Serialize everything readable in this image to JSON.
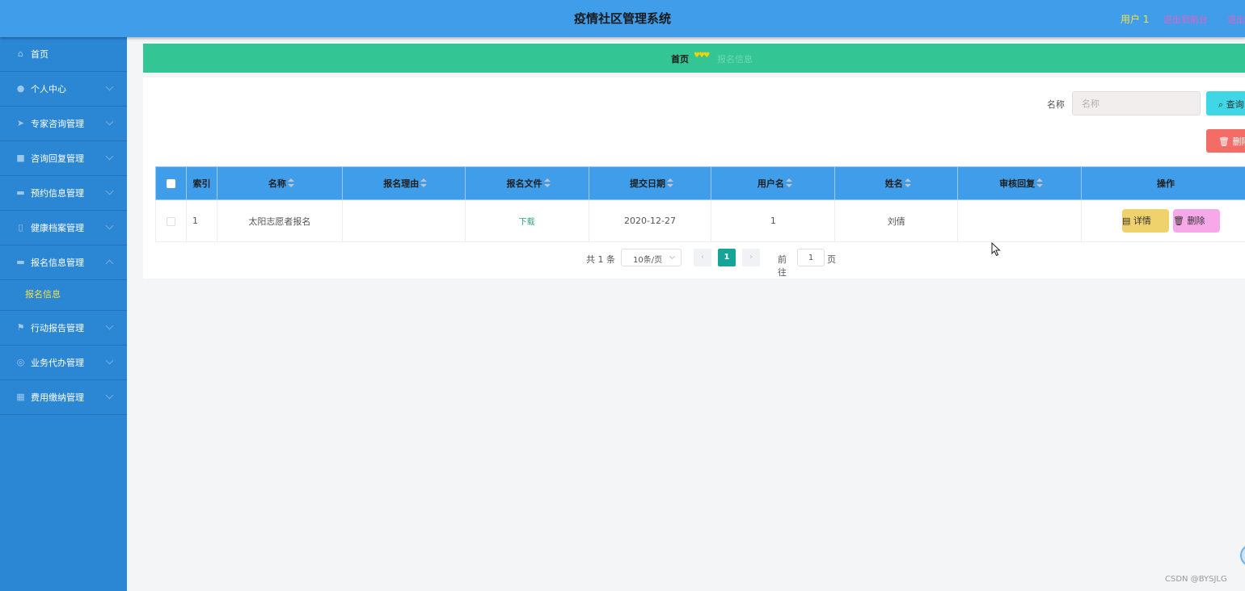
{
  "header": {
    "title": "疫情社区管理系统",
    "user": "用户 1",
    "back_to_front": "退出到前台",
    "logout": "退出"
  },
  "sidebar": {
    "items": [
      {
        "label": "首页",
        "icon": "home-icon"
      },
      {
        "label": "个人中心",
        "icon": "user-icon"
      },
      {
        "label": "专家咨询管理",
        "icon": "send-icon"
      },
      {
        "label": "咨询回复管理",
        "icon": "chat-icon"
      },
      {
        "label": "预约信息管理",
        "icon": "briefcase-icon"
      },
      {
        "label": "健康档案管理",
        "icon": "mobile-icon"
      },
      {
        "label": "报名信息管理",
        "icon": "ticket-icon"
      },
      {
        "label": "行动报告管理",
        "icon": "flag-icon"
      },
      {
        "label": "业务代办管理",
        "icon": "globe-icon"
      },
      {
        "label": "费用缴纳管理",
        "icon": "grid-icon"
      }
    ],
    "submenu_active": "报名信息"
  },
  "breadcrumb": {
    "home": "首页",
    "current": "报名信息"
  },
  "search": {
    "label": "名称",
    "placeholder": "名称",
    "query_button": "查询",
    "delete_button": "删除"
  },
  "table": {
    "columns": [
      "索引",
      "名称",
      "报名理由",
      "报名文件",
      "提交日期",
      "用户名",
      "姓名",
      "审核回复",
      "操作"
    ],
    "rows": [
      {
        "index": "1",
        "name": "太阳志愿者报名",
        "reason": "",
        "file": "下载",
        "date": "2020-12-27",
        "username": "1",
        "realname": "刘倩",
        "reply": ""
      }
    ],
    "detail_button": "详情",
    "delete_button": "删除"
  },
  "pagination": {
    "total": "共 1 条",
    "page_size": "10条/页",
    "current_page": "1",
    "goto_label": "前往",
    "goto_value": "1",
    "page_unit": "页"
  },
  "watermark": "CSDN @BYSJLG"
}
